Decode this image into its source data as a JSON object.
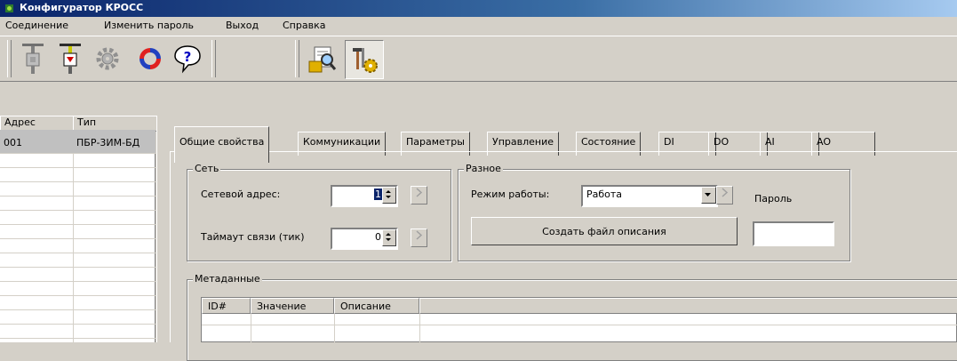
{
  "window": {
    "title": "Конфигуратор КРОСС"
  },
  "menu": [
    "Соединение",
    "Изменить пароль",
    "Выход",
    "Справка"
  ],
  "toolbar": {
    "buttons": [
      "connector-icon",
      "connector-red-icon",
      "gear-icon",
      "refresh-icon",
      "help-icon",
      "inspect-icon",
      "tools-icon"
    ],
    "pressed": "tools-icon"
  },
  "device_list": {
    "columns": [
      "Адрес",
      "Тип"
    ],
    "rows": [
      {
        "address": "001",
        "type": "ПБР-3ИМ-БД"
      }
    ]
  },
  "tabs": [
    "Общие свойства",
    "Коммуникации",
    "Параметры",
    "Управление",
    "Состояние",
    "DI",
    "DO",
    "AI",
    "AO"
  ],
  "active_tab": "Общие свойства",
  "network": {
    "title": "Сеть",
    "address_label": "Сетевой адрес:",
    "address_value": "1",
    "timeout_label": "Таймаут связи (тик)",
    "timeout_value": "0"
  },
  "misc": {
    "title": "Разное",
    "mode_label": "Режим работы:",
    "mode_value": "Работа",
    "password_label": "Пароль",
    "password_value": "",
    "create_button": "Создать файл описания"
  },
  "metadata": {
    "title": "Метаданные",
    "columns": [
      "ID#",
      "Значение",
      "Описание"
    ]
  },
  "colors": {
    "title_bar": "#0a246a",
    "face": "#d4d0c8",
    "selected_row": "#c0c0c0"
  }
}
